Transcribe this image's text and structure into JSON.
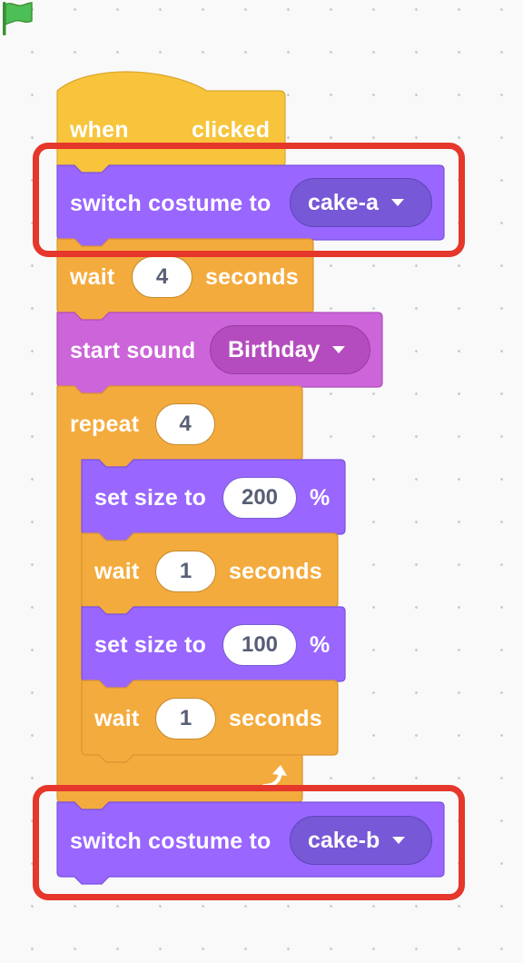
{
  "colors": {
    "events": "#f7c43b",
    "looks": "#9966ff",
    "control": "#f4ab3d",
    "sound": "#cc65d9",
    "highlight": "#e5372b"
  },
  "hat": {
    "when": "when",
    "clicked": "clicked",
    "icon": "green-flag-icon"
  },
  "blocks": {
    "switch_costume_1": {
      "label": "switch costume to",
      "value": "cake-a"
    },
    "wait_1": {
      "label": "wait",
      "value": "4",
      "unit": "seconds"
    },
    "start_sound": {
      "label": "start sound",
      "value": "Birthday"
    },
    "repeat": {
      "label": "repeat",
      "value": "4",
      "loop_icon": "loop-arrow-icon"
    },
    "set_size_1": {
      "label": "set size to",
      "value": "200",
      "unit": "%"
    },
    "wait_2": {
      "label": "wait",
      "value": "1",
      "unit": "seconds"
    },
    "set_size_2": {
      "label": "set size to",
      "value": "100",
      "unit": "%"
    },
    "wait_3": {
      "label": "wait",
      "value": "1",
      "unit": "seconds"
    },
    "switch_costume_2": {
      "label": "switch costume to",
      "value": "cake-b"
    }
  }
}
